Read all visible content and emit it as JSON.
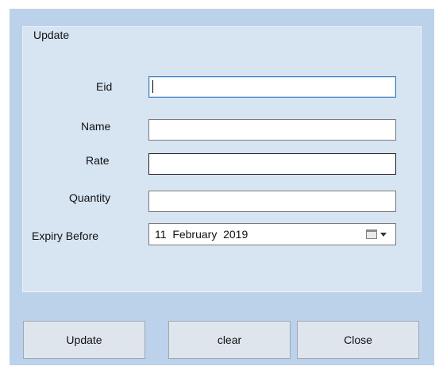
{
  "group": {
    "title": "Update"
  },
  "form": {
    "eid_label": "Eid",
    "eid_value": "",
    "name_label": "Name",
    "name_value": "",
    "rate_label": "Rate",
    "rate_value": "",
    "quantity_label": "Quantity",
    "quantity_value": "",
    "expiry_label": "Expiry Before",
    "expiry_value": "11  February  2019"
  },
  "buttons": {
    "update_label": "Update",
    "clear_label": "clear",
    "close_label": "Close"
  },
  "icons": {
    "calendar": "calendar-icon",
    "dropdown": "chevron-down-icon"
  },
  "colors": {
    "window_bg": "#bcd1ea",
    "group_bg": "#d7e4f2",
    "focus_border": "#3c7fc0"
  }
}
